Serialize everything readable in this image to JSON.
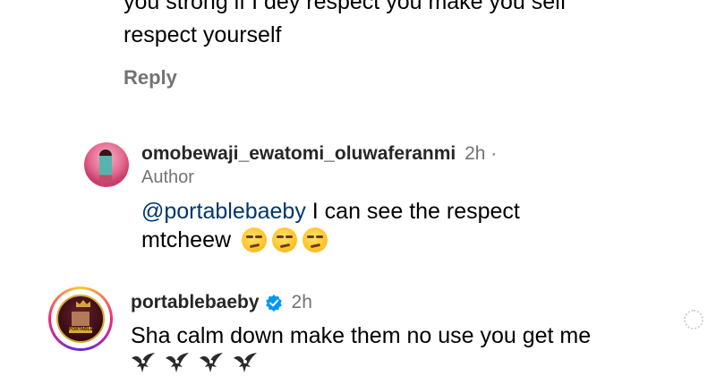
{
  "top_comment": {
    "line1": "you strong if I dey respect you make you self",
    "line2": "respect yourself",
    "reply_label": "Reply"
  },
  "reply1": {
    "username": "omobewaji_ewatomi_oluwaferanmi",
    "time": "2h ·",
    "badge": "Author",
    "mention": "@portablebaeby",
    "text": " I can see the respect",
    "text2": "mtcheew",
    "emoji": [
      "smirking-face",
      "smirking-face",
      "smirking-face"
    ]
  },
  "reply2": {
    "username": "portablebaeby",
    "verified": true,
    "time": "2h",
    "text": "Sha calm down make them no use you get me",
    "emoji": [
      "eagle",
      "eagle",
      "eagle",
      "eagle"
    ],
    "avatar_label": "PORTABLE"
  },
  "colors": {
    "secondary_text": "#737373",
    "mention": "#00376b",
    "verified": "#0095f6"
  }
}
